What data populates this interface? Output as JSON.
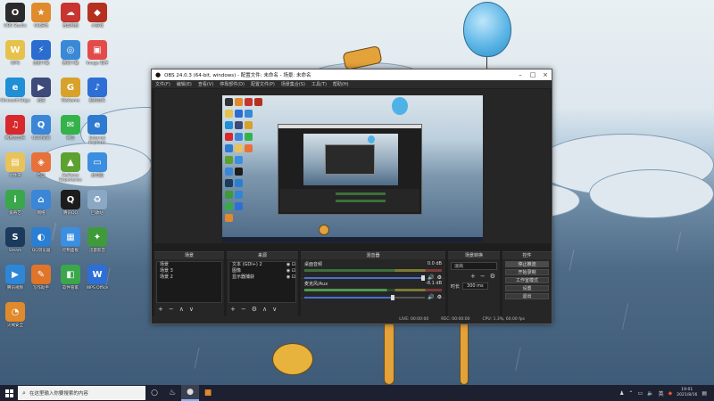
{
  "desktop": {
    "icons": [
      {
        "label": "OBS Studio",
        "glyph": "O",
        "color": "#2b2b2b",
        "name": "obs-studio-desktop-icon"
      },
      {
        "label": "QQ游戏",
        "glyph": "★",
        "color": "#e08a2b",
        "name": "qq-game-desktop-icon"
      },
      {
        "label": "百度网盘",
        "glyph": "☁",
        "color": "#c8342f",
        "name": "baidu-netdisk-desktop-icon"
      },
      {
        "label": "小游戏",
        "glyph": "◆",
        "color": "#b6301f",
        "name": "mini-game-desktop-icon"
      },
      {
        "label": "WPS",
        "glyph": "W",
        "color": "#e7c24a",
        "name": "wps-desktop-icon"
      },
      {
        "label": "迅雷下载",
        "glyph": "⚡",
        "color": "#2b6cd1",
        "name": "thunder-desktop-icon"
      },
      {
        "label": "腾讯下载",
        "glyph": "◎",
        "color": "#3a89d6",
        "name": "tencent-download-desktop-icon"
      },
      {
        "label": "Image 软件",
        "glyph": "▣",
        "color": "#e34b4b",
        "name": "image-app-desktop-icon"
      },
      {
        "label": "Microsoft Edge",
        "glyph": "e",
        "color": "#1f8fd6",
        "name": "edge-desktop-icon"
      },
      {
        "label": "迅雷",
        "glyph": "▶",
        "color": "#3d4a7a",
        "name": "xunlei-desktop-icon"
      },
      {
        "label": "WeGame",
        "glyph": "G",
        "color": "#d8a12a",
        "name": "wegame-desktop-icon"
      },
      {
        "label": "酷狗音乐",
        "glyph": "♪",
        "color": "#2e6fd6",
        "name": "kugou-desktop-icon"
      },
      {
        "label": "网易云音乐",
        "glyph": "♫",
        "color": "#d8282c",
        "name": "netease-music-desktop-icon"
      },
      {
        "label": "QQ浏览器",
        "glyph": "Q",
        "color": "#3c86d8",
        "name": "qq-browser-desktop-icon"
      },
      {
        "label": "微信",
        "glyph": "✉",
        "color": "#35b24a",
        "name": "wechat-desktop-icon"
      },
      {
        "label": "Internet Explorer",
        "glyph": "e",
        "color": "#2d7ad0",
        "name": "ie-desktop-icon"
      },
      {
        "label": "文件夹",
        "glyph": "▤",
        "color": "#e8c35a",
        "name": "folder-desktop-icon"
      },
      {
        "label": "百度",
        "glyph": "◈",
        "color": "#e8713a",
        "name": "baidu-desktop-icon"
      },
      {
        "label": "GeForce Experience",
        "glyph": "▲",
        "color": "#5da130",
        "name": "geforce-desktop-icon"
      },
      {
        "label": "此电脑",
        "glyph": "▭",
        "color": "#3b8ee0",
        "name": "this-pc-desktop-icon"
      },
      {
        "label": "爱奇艺",
        "glyph": "i",
        "color": "#3aa84a",
        "name": "iqiyi-desktop-icon"
      },
      {
        "label": "网络",
        "glyph": "⌂",
        "color": "#3b86d6",
        "name": "network-desktop-icon"
      },
      {
        "label": "腾讯QQ",
        "glyph": "Q",
        "color": "#1c1c1c",
        "name": "tencent-qq-desktop-icon"
      },
      {
        "label": "回收站",
        "glyph": "♻",
        "color": "#8aa8c4",
        "name": "recycle-bin-desktop-icon"
      },
      {
        "label": "Steam",
        "glyph": "S",
        "color": "#1b3a5c",
        "name": "steam-desktop-icon"
      },
      {
        "label": "QQ浏览器",
        "glyph": "◐",
        "color": "#2a7fd4",
        "name": "qq-browser2-desktop-icon"
      },
      {
        "label": "控制面板",
        "glyph": "▦",
        "color": "#3b8ee0",
        "name": "control-panel-desktop-icon"
      },
      {
        "label": "迅雷影音",
        "glyph": "✦",
        "color": "#3f9a3a",
        "name": "xunlei-player-desktop-icon"
      },
      {
        "label": "腾讯视频",
        "glyph": "▶",
        "color": "#2d86d6",
        "name": "tencent-video-desktop-icon"
      },
      {
        "label": "写作助手",
        "glyph": "✎",
        "color": "#e0752a",
        "name": "writing-desktop-icon"
      },
      {
        "label": "软件管家",
        "glyph": "◧",
        "color": "#3aa84a",
        "name": "software-manager-desktop-icon"
      },
      {
        "label": "WPS Office",
        "glyph": "W",
        "color": "#2d6fd6",
        "name": "wps-office-desktop-icon"
      },
      {
        "label": "火绒安全",
        "glyph": "◔",
        "color": "#e08a2b",
        "name": "huorong-desktop-icon"
      }
    ]
  },
  "obs": {
    "title": "OBS 24.0.3 (64-bit, windows) - 配置文件: 未命名 - 场景: 未命名",
    "menu": [
      "文件(F)",
      "编辑(E)",
      "查看(V)",
      "停靠部件(D)",
      "配置文件(P)",
      "场景集合(S)",
      "工具(T)",
      "帮助(H)"
    ],
    "docks": {
      "scenes": {
        "header": "场景",
        "items": [
          "场景",
          "场景 3",
          "场景 2"
        ]
      },
      "sources": {
        "header": "来源",
        "items": [
          "文本 (GDI+) 2",
          "图像",
          "显示器捕获"
        ]
      },
      "mixer": {
        "header": "混音器",
        "channels": [
          {
            "name": "桌面音频",
            "db": "0.0 dB"
          },
          {
            "name": "麦克风/Aux",
            "db": "-8.1 dB"
          }
        ]
      },
      "transitions": {
        "header": "场景转换",
        "type": "淡出",
        "duration_label": "时长",
        "duration": "300 ms"
      },
      "controls": {
        "header": "控件",
        "buttons": [
          "停止推流",
          "开始录制",
          "工作室模式",
          "设置",
          "退出"
        ]
      }
    },
    "status": {
      "live": "LIVE: 00:00:00",
      "rec": "REC: 00:00:00",
      "cpu": "CPU: 1.3%, 60.00 fps"
    }
  },
  "taskbar": {
    "search_placeholder": "在这里输入你要搜索的内容",
    "time": "19:01",
    "date": "2021/8/16"
  }
}
